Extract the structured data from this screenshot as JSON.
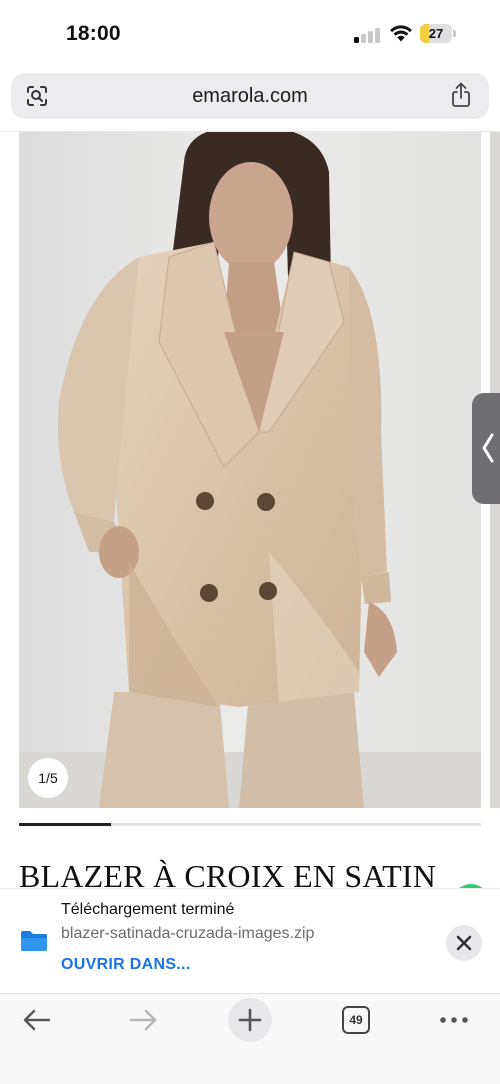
{
  "status_bar": {
    "time": "18:00",
    "battery_level": "27",
    "battery_fraction": 0.27,
    "signal_bars_on": 1,
    "battery_color": "#f4d03f"
  },
  "browser": {
    "url": "emarola.com",
    "left_icon": "page-tools-icon",
    "right_icon": "share-icon"
  },
  "product": {
    "image_alt": "Model wearing beige double-breasted satin blazer",
    "image_counter": "1/5",
    "carousel_progress": 0.2,
    "title": "BLAZER À CROIX EN SATIN"
  },
  "download": {
    "title": "Téléchargement terminé",
    "filename": "blazer-satinada-cruzada-images.zip",
    "open_label": "OUVRIR DANS...",
    "icon": "folder-icon",
    "accent": "#1a73e8"
  },
  "bottom_nav": {
    "tab_count": "49",
    "icons": [
      "back-arrow-icon",
      "forward-arrow-icon",
      "plus-icon",
      "tabs-icon",
      "more-icon"
    ]
  }
}
